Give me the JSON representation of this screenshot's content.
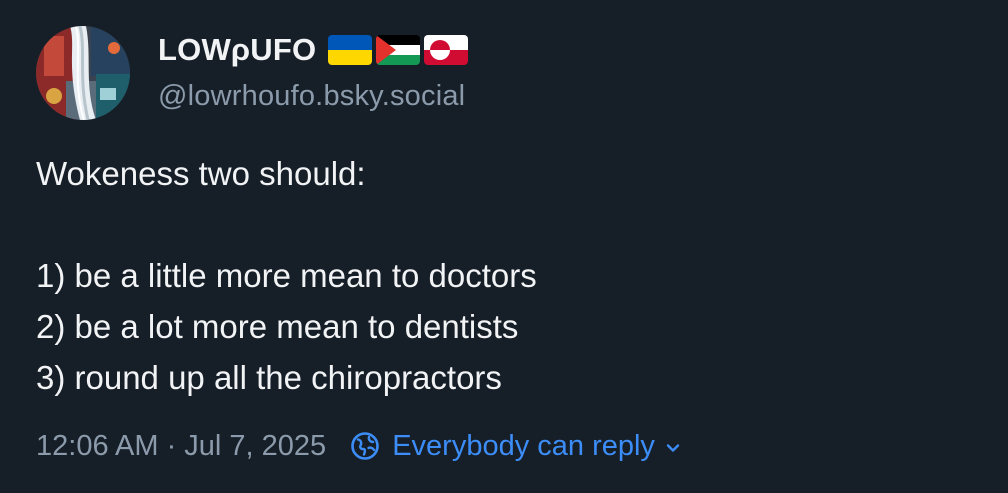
{
  "author": {
    "display_name": "LOWρUFO",
    "handle": "@lowrhoufo.bsky.social",
    "flags": [
      {
        "icon": "ukraine-flag-icon",
        "colors": [
          "#0057b7",
          "#ffd700"
        ]
      },
      {
        "icon": "palestine-flag-icon",
        "colors": [
          "#000000",
          "#ffffff",
          "#149954",
          "#e4312b"
        ]
      },
      {
        "icon": "greenland-flag-icon",
        "colors": [
          "#ffffff",
          "#d00c33"
        ]
      }
    ]
  },
  "post": {
    "lines": [
      "Wokeness two should:",
      "",
      "1) be a little more mean to doctors",
      "2) be a lot more mean to dentists",
      "3) round up all the chiropractors"
    ]
  },
  "meta": {
    "timestamp": "12:06 AM · Jul 7, 2025",
    "reply_setting": "Everybody can reply",
    "reply_icon": "globe-icon",
    "dropdown_icon": "chevron-down-icon"
  },
  "colors": {
    "background": "#161e27",
    "text": "#f1f3f5",
    "muted": "#8c9bab",
    "accent": "#3c8df7"
  }
}
